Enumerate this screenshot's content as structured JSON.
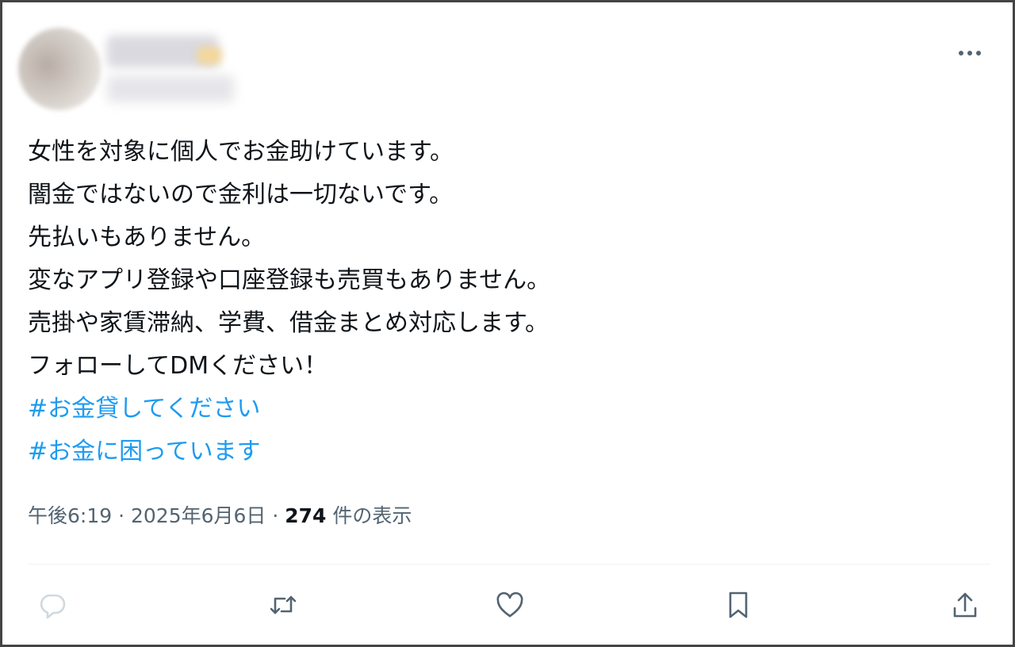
{
  "tweet": {
    "lines": [
      "女性を対象に個人でお金助けています。",
      "闇金ではないので金利は一切ないです。",
      "先払いもありません。",
      "変なアプリ登録や口座登録も売買もありません。",
      "売掛や家賃滞納、学費、借金まとめ対応します。",
      "フォローしてDMください！"
    ],
    "hashtags": [
      "#お金貸してください",
      "#お金に困っています"
    ],
    "meta": {
      "time": "午後6:19",
      "separator": " · ",
      "date": "2025年6月6日",
      "views_count": "274",
      "views_label": " 件の表示"
    }
  },
  "icons": {
    "more": "more-horizontal-icon",
    "reply": "reply-icon",
    "retweet": "retweet-icon",
    "like": "heart-icon",
    "bookmark": "bookmark-icon",
    "share": "share-icon"
  },
  "colors": {
    "text": "#0f1419",
    "secondary": "#536471",
    "hashtag": "#1d9bf0",
    "reply_icon": "#cfd9de",
    "action_icon": "#536471",
    "frame": "#444444"
  }
}
